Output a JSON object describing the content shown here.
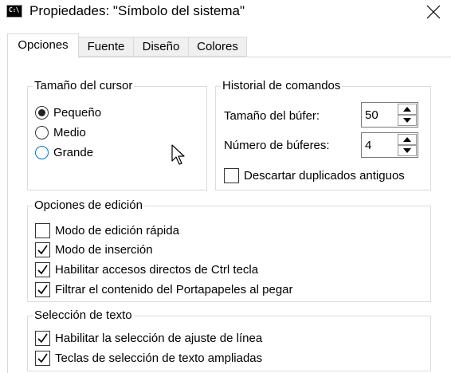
{
  "window": {
    "title": "Propiedades: \"Símbolo del sistema\"",
    "icon_text": "C:\\",
    "icon_name": "console-icon",
    "close_icon": "close-icon"
  },
  "tabs": [
    {
      "label": "Opciones",
      "active": true
    },
    {
      "label": "Fuente",
      "active": false
    },
    {
      "label": "Diseño",
      "active": false
    },
    {
      "label": "Colores",
      "active": false
    }
  ],
  "cursor_size": {
    "legend": "Tamaño del cursor",
    "options": [
      {
        "label": "Pequeño",
        "selected": true
      },
      {
        "label": "Medio",
        "selected": false
      },
      {
        "label": "Grande",
        "selected": false
      }
    ]
  },
  "history": {
    "legend": "Historial de comandos",
    "buffer_size_label": "Tamaño del búfer:",
    "buffer_size_value": "50",
    "buffer_count_label": "Número de búferes:",
    "buffer_count_value": "4",
    "discard_label": "Descartar duplicados antiguos",
    "discard_checked": false
  },
  "edit_options": {
    "legend": "Opciones de edición",
    "items": [
      {
        "label": "Modo de edición rápida",
        "checked": false
      },
      {
        "label": "Modo de inserción",
        "checked": true
      },
      {
        "label": "Habilitar accesos directos de Ctrl tecla",
        "checked": true
      },
      {
        "label": "Filtrar el contenido del Portapapeles al pegar",
        "checked": true
      }
    ]
  },
  "text_selection": {
    "legend": "Selección de texto",
    "items": [
      {
        "label": "Habilitar la selección de ajuste de línea",
        "checked": true
      },
      {
        "label": "Teclas de selección de texto ampliadas",
        "checked": true
      }
    ]
  },
  "colors": {
    "focus_blue": "#0078d7",
    "group_border": "#dcdcdc"
  }
}
